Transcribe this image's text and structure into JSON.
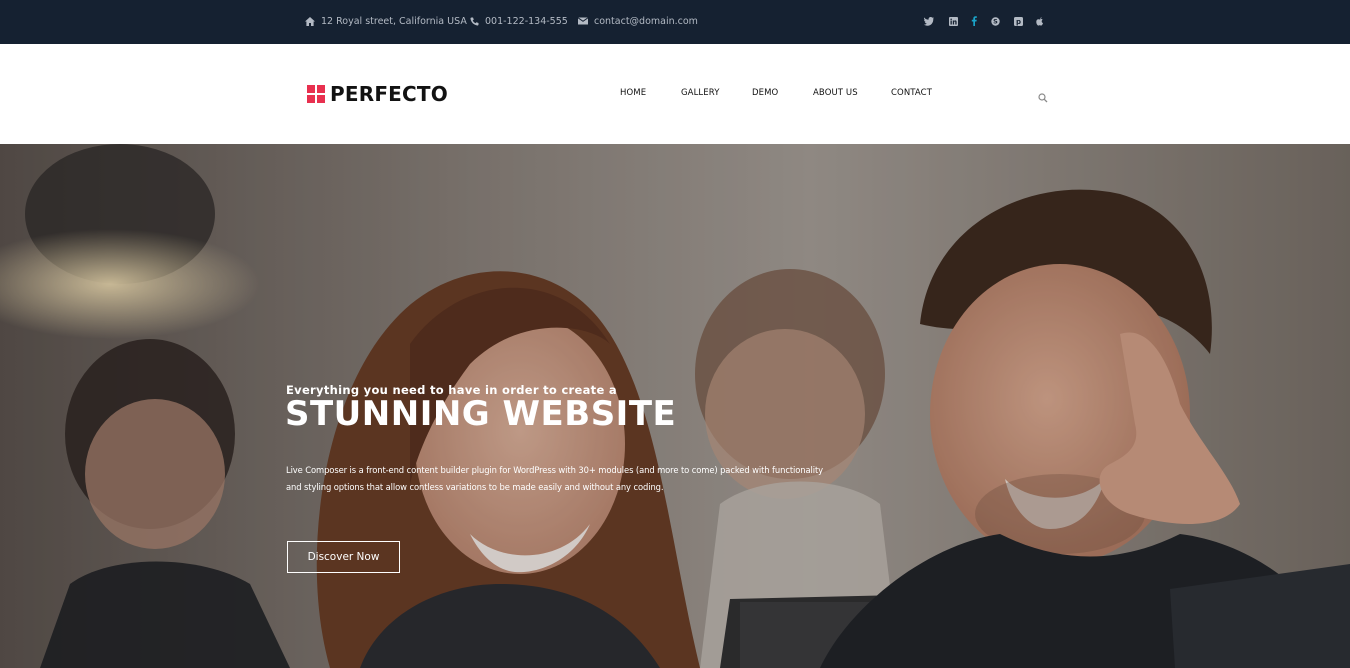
{
  "topbar": {
    "address": "12 Royal street, California USA",
    "phone": "001-122-134-555",
    "email": "contact@domain.com",
    "social_icons": [
      "twitter-icon",
      "linkedin-icon",
      "facebook-icon",
      "skype-icon",
      "pinterest-icon",
      "apple-icon"
    ],
    "colors": {
      "background": "#152131",
      "text": "#b3bac4",
      "icon": "#b3bac4",
      "facebook": "#1aa3c8"
    }
  },
  "header": {
    "logo_text": "PERFECTO",
    "logo_color": "#e8304f",
    "nav": [
      "HOME",
      "GALLERY",
      "DEMO",
      "ABOUT US",
      "CONTACT"
    ],
    "search_icon": "search-icon"
  },
  "hero": {
    "kicker": "Everything you need to have in order to create a",
    "title": "STUNNING WEBSITE",
    "description": "Live Composer is a front-end content builder plugin for WordPress with 30+ modules (and more to come) packed with functionality and styling options that allow contless variations to be made easily and without any coding.",
    "button_label": "Discover Now"
  }
}
